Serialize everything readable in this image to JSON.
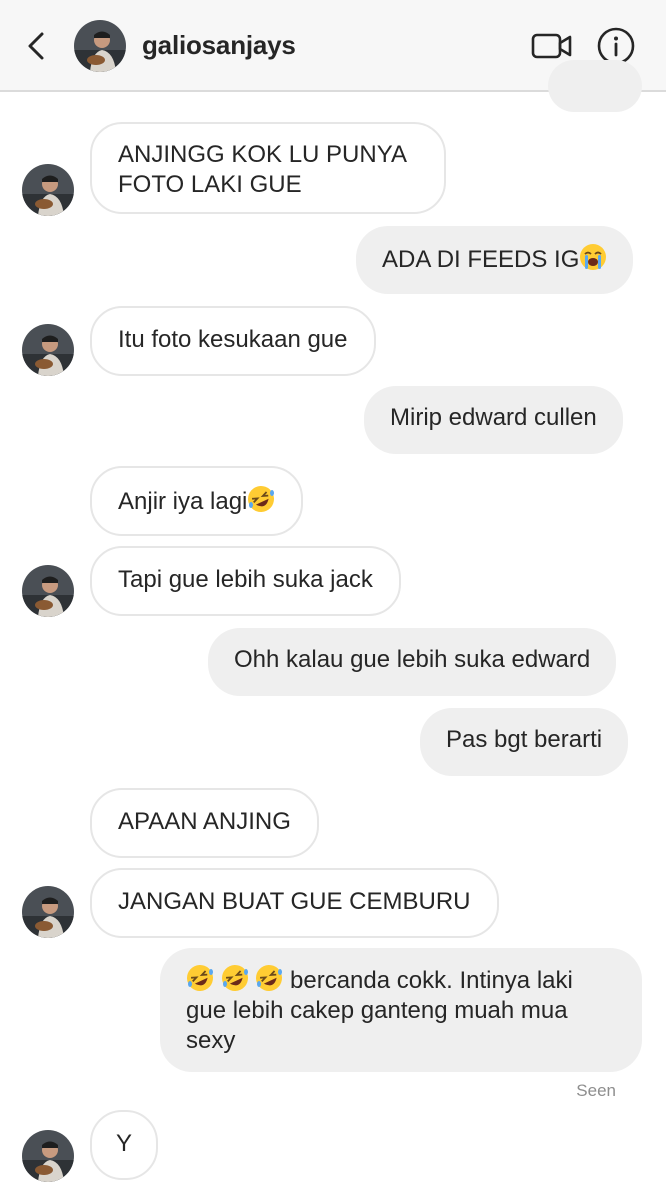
{
  "header": {
    "username": "galiosanjays",
    "back_icon": "chevron-left-icon",
    "video_icon": "video-camera-icon",
    "info_icon": "info-icon"
  },
  "messages": [
    {
      "side": "in",
      "text": "ANJINGG KOK LU PUNYA FOTO LAKI GUE"
    },
    {
      "side": "out",
      "text": "ADA DI FEEDS IG",
      "emoji": "loudly-crying-face"
    },
    {
      "side": "in",
      "text": "Itu foto kesukaan gue"
    },
    {
      "side": "out",
      "text": "Mirip edward cullen"
    },
    {
      "side": "in",
      "text": "Anjir iya lagi",
      "emoji": "rolling-on-floor-laughing"
    },
    {
      "side": "in",
      "text": "Tapi gue lebih suka jack"
    },
    {
      "side": "out",
      "text": "Ohh kalau gue lebih suka edward"
    },
    {
      "side": "out",
      "text": "Pas bgt berarti"
    },
    {
      "side": "in",
      "text": "APAAN ANJING"
    },
    {
      "side": "in",
      "text": "JANGAN BUAT GUE CEMBURU"
    },
    {
      "side": "out",
      "text": "bercanda cokk. Intinya laki gue lebih cakep ganteng muah mua sexy",
      "emoji": "rolling-on-floor-laughing"
    },
    {
      "side": "in",
      "text": "Y"
    }
  ],
  "status": {
    "seen": "Seen"
  },
  "colors": {
    "incoming_bubble": "#ffffff",
    "outgoing_bubble": "#efefef",
    "border": "#e6e6e6",
    "muted": "#8e8e8e"
  }
}
